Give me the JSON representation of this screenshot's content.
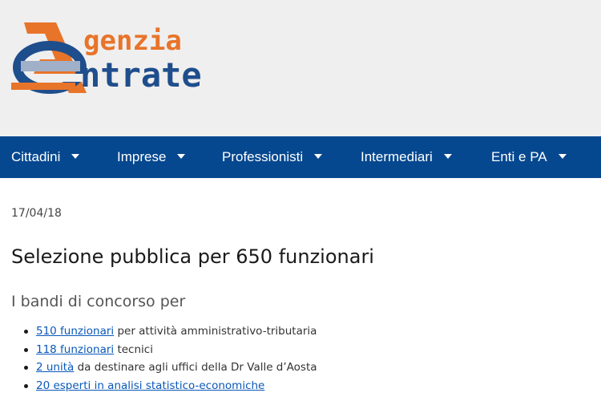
{
  "logo": {
    "line1_letter": "A",
    "line1_text": "genzia",
    "line2_letter": "E",
    "line2_text": "ntrate",
    "colors": {
      "orange": "#e8742a",
      "blue": "#1f4e8c",
      "steel": "#5b6f8e"
    }
  },
  "nav": {
    "background": "#06488f",
    "items": [
      {
        "label": "Cittadini"
      },
      {
        "label": "Imprese"
      },
      {
        "label": "Professionisti"
      },
      {
        "label": "Intermediari"
      },
      {
        "label": "Enti e PA"
      }
    ]
  },
  "article": {
    "date": "17/04/18",
    "title": "Selezione pubblica per 650 funzionari",
    "subtitle": "I bandi di concorso per",
    "items": [
      {
        "link": "510 funzionari",
        "text": " per attività amministrativo-tributaria"
      },
      {
        "link": "118 funzionari",
        "text": " tecnici"
      },
      {
        "link": "2 unità",
        "text": " da destinare agli uffici della Dr Valle d’Aosta"
      },
      {
        "link": "20 esperti in analisi statistico-economiche",
        "text": ""
      }
    ]
  }
}
